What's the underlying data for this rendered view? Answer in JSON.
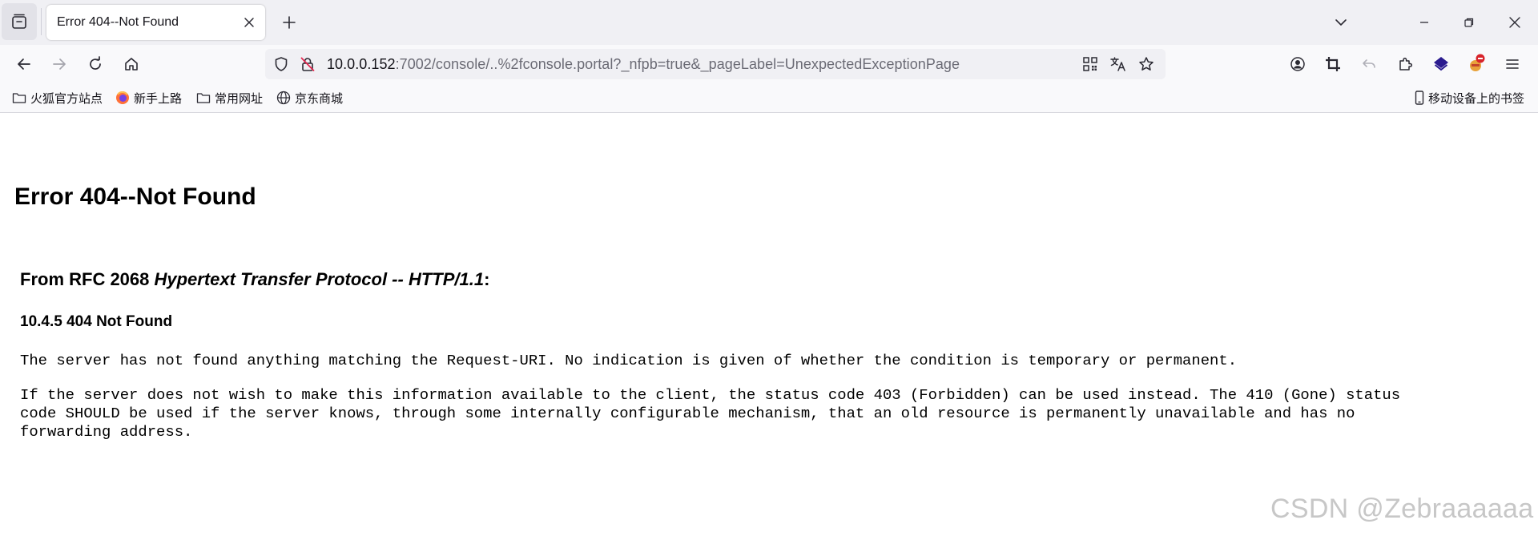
{
  "browser": {
    "tab_title": "Error 404--Not Found",
    "url_host": "10.0.0.152",
    "url_path": ":7002/console/..%2fconsole.portal?_nfpb=true&_pageLabel=UnexpectedExceptionPage",
    "accent_color": "#2b1b8f"
  },
  "bookmarks": {
    "items": [
      {
        "label": "火狐官方站点",
        "icon": "folder-icon"
      },
      {
        "label": "新手上路",
        "icon": "firefox-icon"
      },
      {
        "label": "常用网址",
        "icon": "folder-icon"
      },
      {
        "label": "京东商城",
        "icon": "globe-icon"
      }
    ],
    "mobile": "移动设备上的书签"
  },
  "page": {
    "title": "Error 404--Not Found",
    "rfc_prefix": "From RFC 2068 ",
    "rfc_title": "Hypertext Transfer Protocol -- HTTP/1.1",
    "rfc_suffix": ":",
    "section": "10.4.5 404 Not Found",
    "para1": "The server has not found anything matching the Request-URI. No indication is given of whether the condition is temporary or permanent.",
    "para2_line1": "If the server does not wish to make this information available to the client, the status code 403 (Forbidden) can be used instead. The 410 (Gone) status",
    "para2_line2": "code SHOULD be used if the server knows, through some internally configurable mechanism, that an old resource is permanently unavailable and has no",
    "para2_line3": "forwarding address."
  },
  "watermark": "CSDN @Zebraaaaaa"
}
